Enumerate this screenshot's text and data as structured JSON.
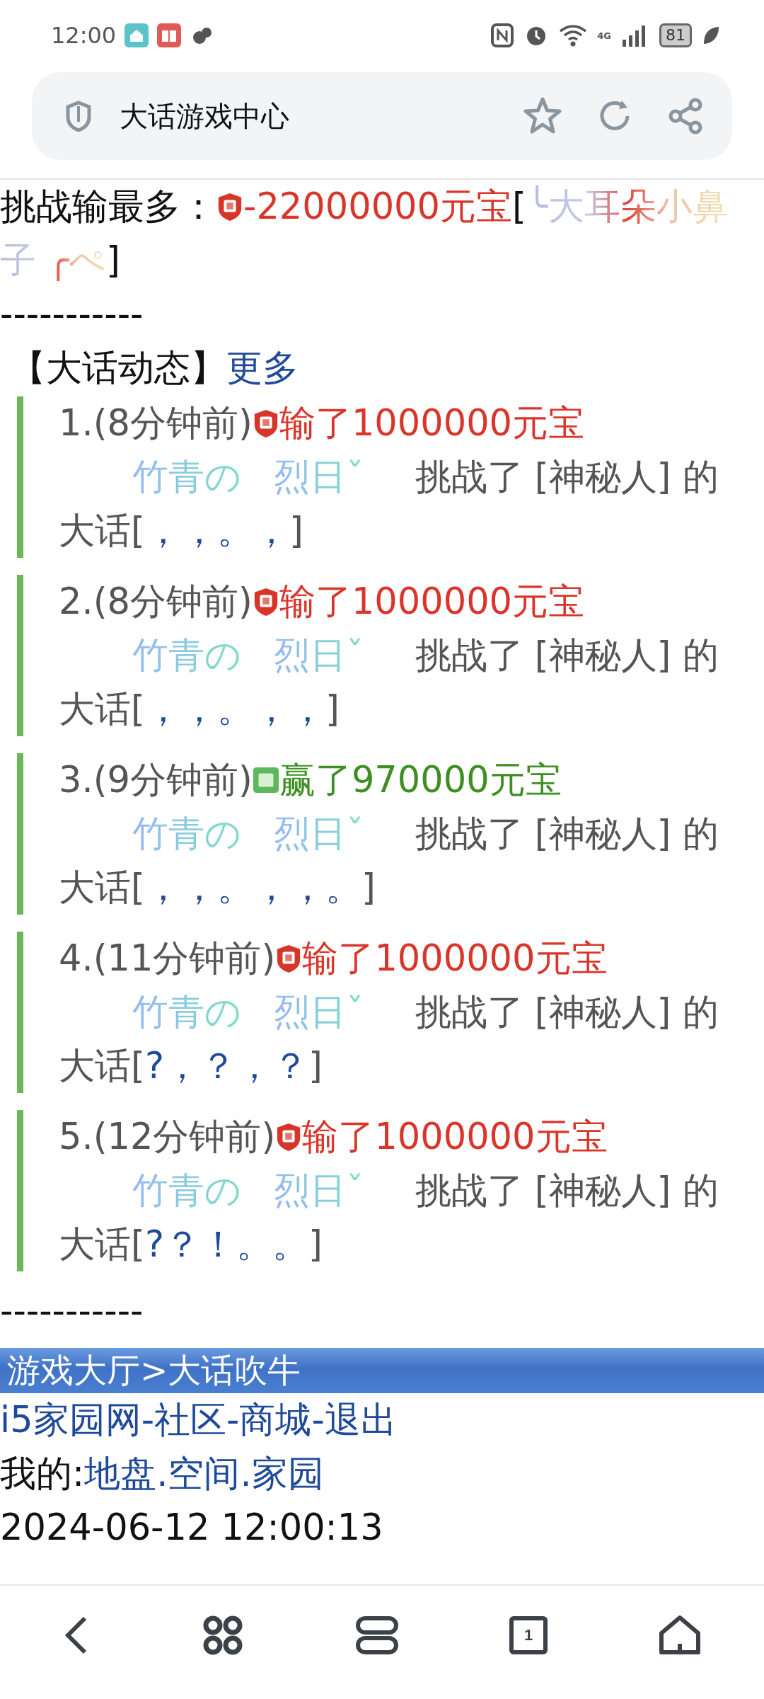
{
  "status_bar": {
    "time": "12:00",
    "network": "4G",
    "battery": "81"
  },
  "address_bar": {
    "title": "大话游戏中心"
  },
  "top_record": {
    "label": "挑战输最多：",
    "amount": "-22000000元宝",
    "open": "[",
    "player": [
      "╰大耳朵小鼻",
      "子 ╭ぺ"
    ],
    "close": "]"
  },
  "divider_text": "-----------",
  "section": {
    "title": "【大话动态】",
    "more": "更多"
  },
  "feed": [
    {
      "index": "1.",
      "time": "(8分钟前)",
      "kind": "lose",
      "result": "输了1000000元宝",
      "players": [
        "竹青の",
        "烈日ˇ"
      ],
      "text": "挑战了 [神秘人] 的",
      "prefix": "大话[",
      "speech": "，，。，",
      "close": "]"
    },
    {
      "index": "2.",
      "time": "(8分钟前)",
      "kind": "lose",
      "result": "输了1000000元宝",
      "players": [
        "竹青の",
        "烈日ˇ"
      ],
      "text": "挑战了 [神秘人] 的",
      "prefix": "大话[",
      "speech": "，，。，，",
      "close": "]"
    },
    {
      "index": "3.",
      "time": "(9分钟前)",
      "kind": "win",
      "result": "赢了970000元宝",
      "players": [
        "竹青の",
        "烈日ˇ"
      ],
      "text": "挑战了 [神秘人] 的",
      "prefix": "大话[",
      "speech": "，，。，，。",
      "close": "]"
    },
    {
      "index": "4.",
      "time": "(11分钟前)",
      "kind": "lose",
      "result": "输了1000000元宝",
      "players": [
        "竹青の",
        "烈日ˇ"
      ],
      "text": "挑战了 [神秘人] 的",
      "prefix": "大话[",
      "speech": "?，？，？",
      "close": "]"
    },
    {
      "index": "5.",
      "time": "(12分钟前)",
      "kind": "lose",
      "result": "输了1000000元宝",
      "players": [
        "竹青の",
        "烈日ˇ"
      ],
      "text": "挑战了 [神秘人] 的",
      "prefix": "大话[",
      "speech": "?？！。。",
      "close": "]"
    }
  ],
  "divider_text_2": "-----------",
  "breadcrumb": "游戏大厅>大话吹牛",
  "site_links": {
    "items": [
      "i5家园网",
      "社区",
      "商城",
      "退出"
    ],
    "separator": "-"
  },
  "my_links": {
    "label": "我的:",
    "items": [
      "地盘",
      "空间",
      "家园"
    ],
    "separator": "."
  },
  "timestamp": "2024-06-12 12:00:13",
  "tab_count": "1"
}
